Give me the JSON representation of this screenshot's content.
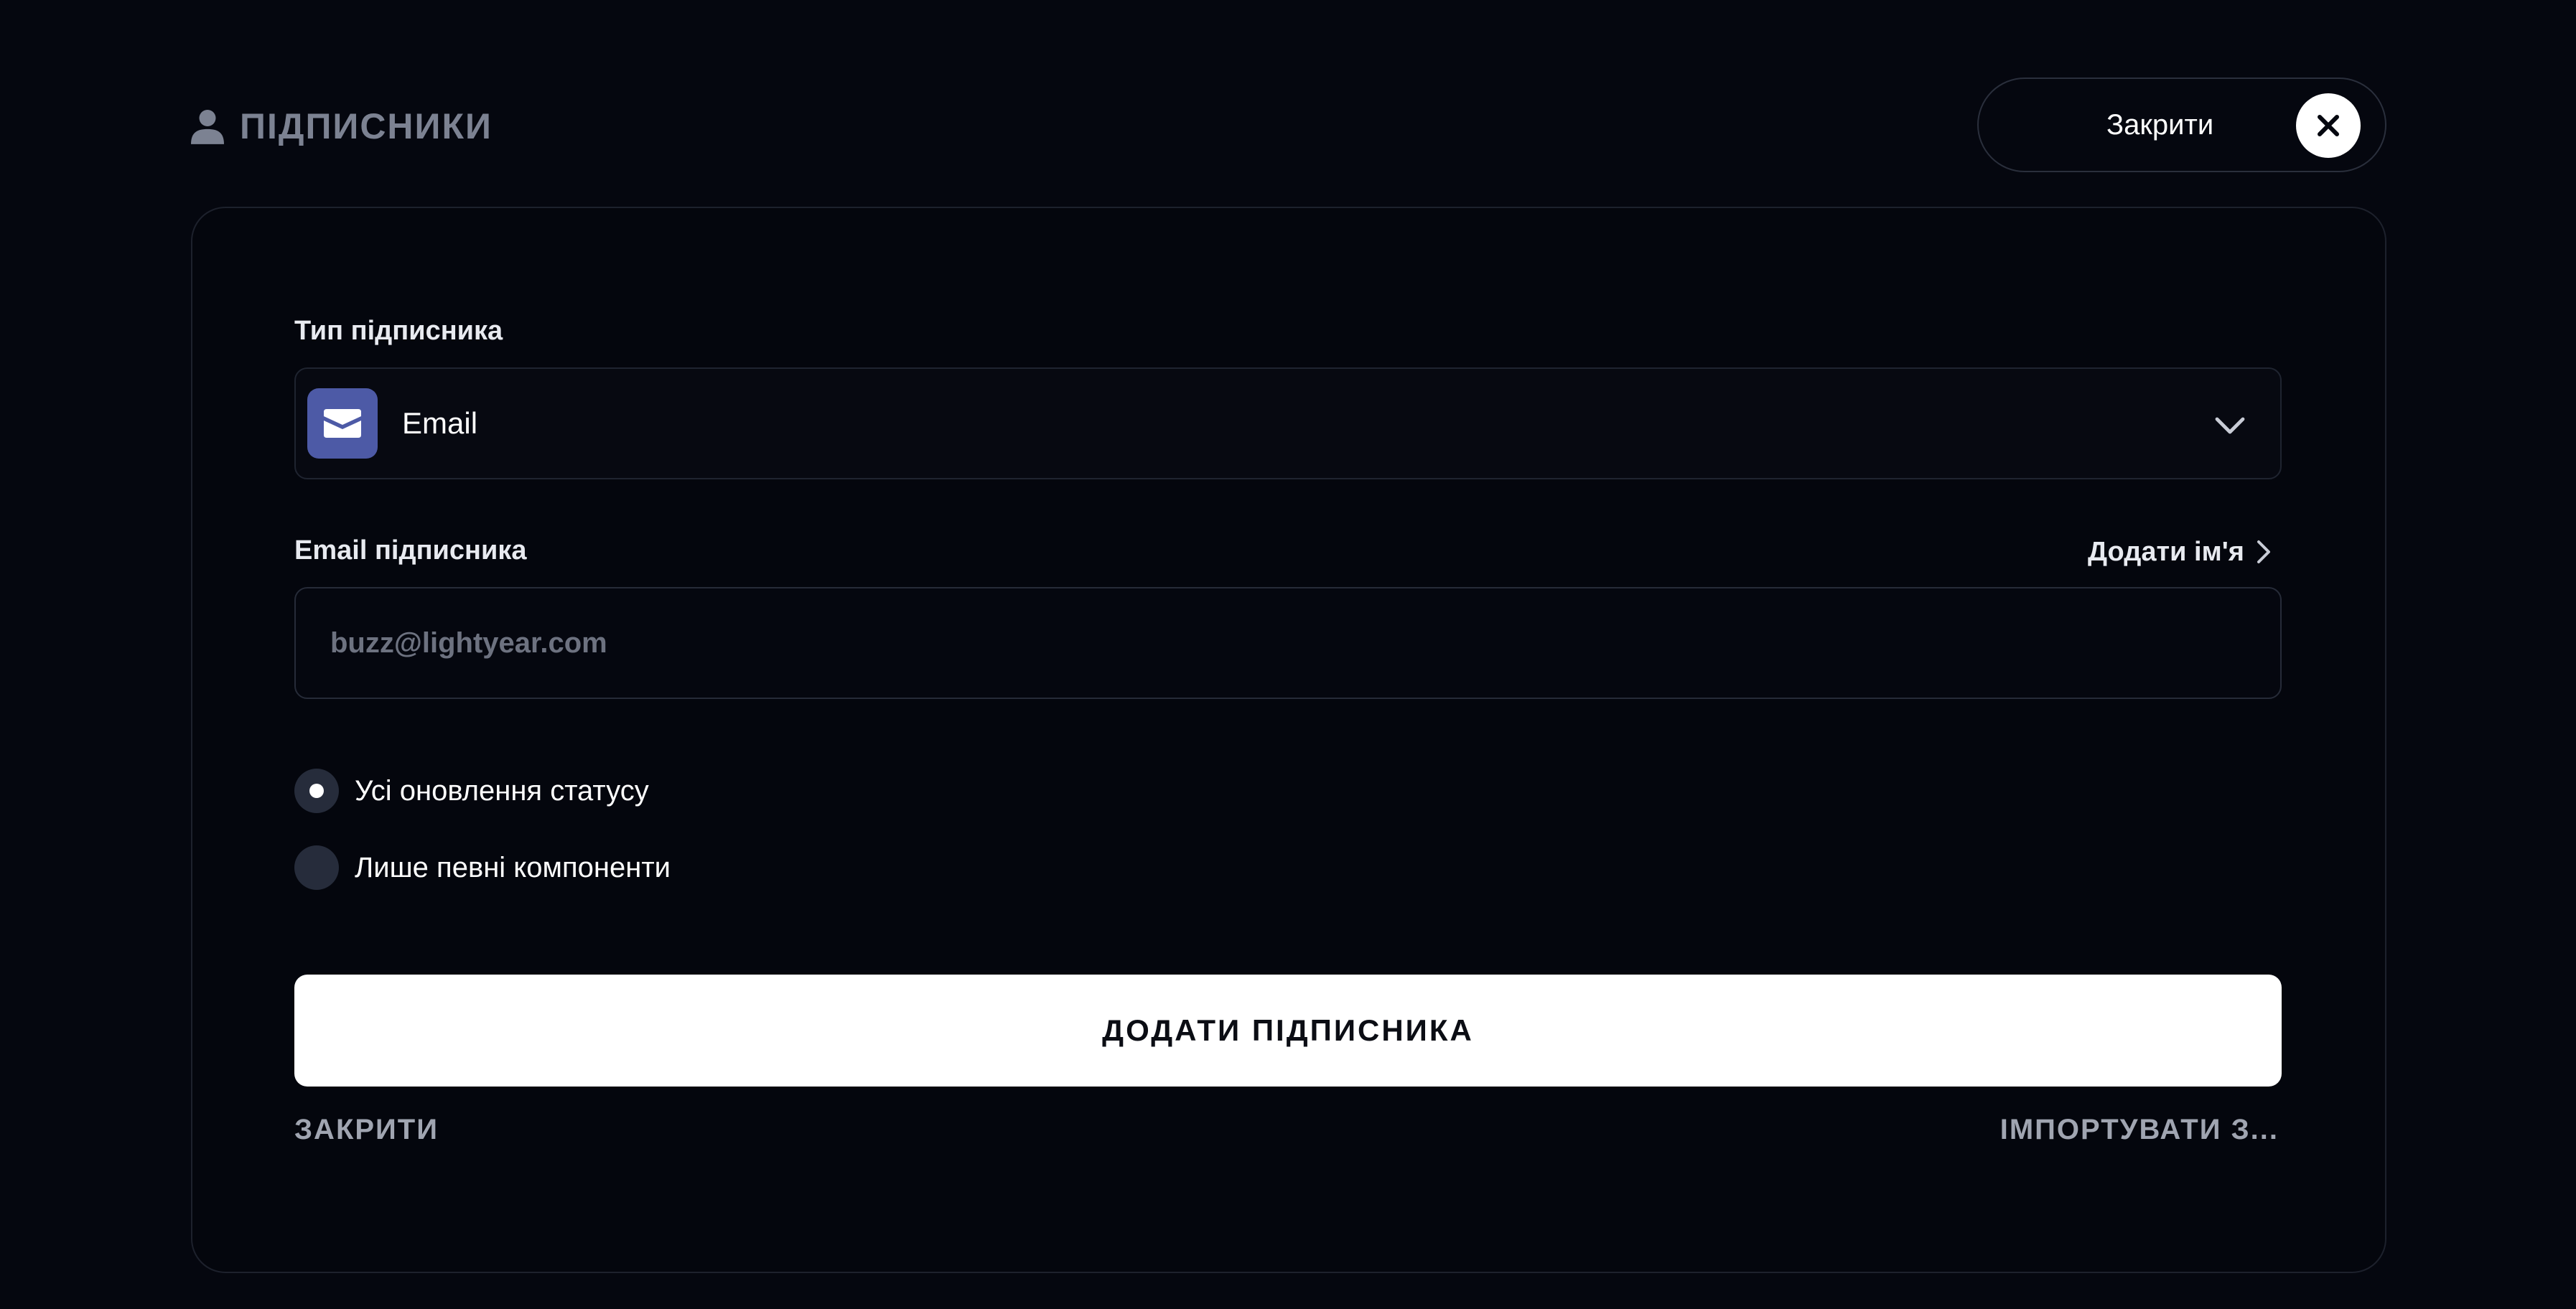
{
  "header": {
    "title": "ПІДПИСНИКИ",
    "title_icon": "person-icon",
    "close_label": "Закрити",
    "close_icon": "close-icon"
  },
  "form": {
    "type_label": "Тип підписника",
    "type_select": {
      "value": "Email",
      "icon": "envelope-icon",
      "icon_bg": "#4d5aa6"
    },
    "email_label": "Email підписника",
    "add_name_label": "Додати ім'я",
    "email_input": {
      "value": "",
      "placeholder": "buzz@lightyear.com"
    },
    "radio_options": [
      {
        "label": "Усі оновлення статусу",
        "selected": true
      },
      {
        "label": "Лише певні компоненти",
        "selected": false
      }
    ],
    "submit_label": "ДОДАТИ ПІДПИСНИКА",
    "cancel_label": "ЗАКРИТИ",
    "import_label": "ІМПОРТУВАТИ З..."
  },
  "colors": {
    "background": "#05070f",
    "accent": "#4d5aa6",
    "primary_button": "#ffffff"
  }
}
